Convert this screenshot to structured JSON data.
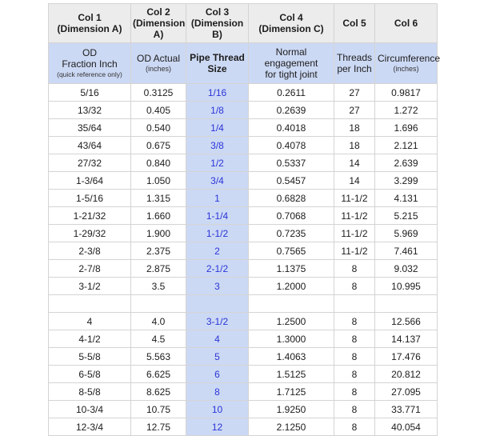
{
  "table": {
    "header_top": [
      {
        "line1": "Col 1",
        "line2": "(Dimension A)"
      },
      {
        "line1": "Col 2",
        "line2": "(Dimension A)"
      },
      {
        "line1": "Col 3",
        "line2": "(Dimension B)"
      },
      {
        "line1": "Col 4",
        "line2": "(Dimension C)"
      },
      {
        "line1": "Col 5",
        "line2": ""
      },
      {
        "line1": "Col 6",
        "line2": ""
      }
    ],
    "header_sub": [
      {
        "line1": "OD",
        "line2": "Fraction Inch",
        "note": "(quick reference only)",
        "bold": false
      },
      {
        "line1": "OD Actual",
        "line2": "",
        "note": "(inches)",
        "bold": false
      },
      {
        "line1": "Pipe Thread",
        "line2": "Size",
        "note": "",
        "bold": true
      },
      {
        "line1": "Normal engagement",
        "line2": "for tight joint",
        "note": "",
        "bold": false
      },
      {
        "line1": "Threads",
        "line2": "per Inch",
        "note": "",
        "bold": false
      },
      {
        "line1": "Circumference",
        "line2": "",
        "note": "(inches)",
        "bold": false
      }
    ],
    "rows": [
      {
        "od_fraction": "5/16",
        "od_actual": "0.3125",
        "pipe_thread_size": "1/16",
        "normal_engagement": "0.2611",
        "threads_per_inch": "27",
        "circumference": "0.9817"
      },
      {
        "od_fraction": "13/32",
        "od_actual": "0.405",
        "pipe_thread_size": "1/8",
        "normal_engagement": "0.2639",
        "threads_per_inch": "27",
        "circumference": "1.272"
      },
      {
        "od_fraction": "35/64",
        "od_actual": "0.540",
        "pipe_thread_size": "1/4",
        "normal_engagement": "0.4018",
        "threads_per_inch": "18",
        "circumference": "1.696"
      },
      {
        "od_fraction": "43/64",
        "od_actual": "0.675",
        "pipe_thread_size": "3/8",
        "normal_engagement": "0.4078",
        "threads_per_inch": "18",
        "circumference": "2.121"
      },
      {
        "od_fraction": "27/32",
        "od_actual": "0.840",
        "pipe_thread_size": "1/2",
        "normal_engagement": "0.5337",
        "threads_per_inch": "14",
        "circumference": "2.639"
      },
      {
        "od_fraction": "1-3/64",
        "od_actual": "1.050",
        "pipe_thread_size": "3/4",
        "normal_engagement": "0.5457",
        "threads_per_inch": "14",
        "circumference": "3.299"
      },
      {
        "od_fraction": "1-5/16",
        "od_actual": "1.315",
        "pipe_thread_size": "1",
        "normal_engagement": "0.6828",
        "threads_per_inch": "11-1/2",
        "circumference": "4.131"
      },
      {
        "od_fraction": "1-21/32",
        "od_actual": "1.660",
        "pipe_thread_size": "1-1/4",
        "normal_engagement": "0.7068",
        "threads_per_inch": "11-1/2",
        "circumference": "5.215"
      },
      {
        "od_fraction": "1-29/32",
        "od_actual": "1.900",
        "pipe_thread_size": "1-1/2",
        "normal_engagement": "0.7235",
        "threads_per_inch": "11-1/2",
        "circumference": "5.969"
      },
      {
        "od_fraction": "2-3/8",
        "od_actual": "2.375",
        "pipe_thread_size": "2",
        "normal_engagement": "0.7565",
        "threads_per_inch": "11-1/2",
        "circumference": "7.461"
      },
      {
        "od_fraction": "2-7/8",
        "od_actual": "2.875",
        "pipe_thread_size": "2-1/2",
        "normal_engagement": "1.1375",
        "threads_per_inch": "8",
        "circumference": "9.032"
      },
      {
        "od_fraction": "3-1/2",
        "od_actual": "3.5",
        "pipe_thread_size": "3",
        "normal_engagement": "1.2000",
        "threads_per_inch": "8",
        "circumference": "10.995"
      },
      {
        "od_fraction": "4",
        "od_actual": "4.0",
        "pipe_thread_size": "3-1/2",
        "normal_engagement": "1.2500",
        "threads_per_inch": "8",
        "circumference": "12.566"
      },
      {
        "od_fraction": "4-1/2",
        "od_actual": "4.5",
        "pipe_thread_size": "4",
        "normal_engagement": "1.3000",
        "threads_per_inch": "8",
        "circumference": "14.137"
      },
      {
        "od_fraction": "5-5/8",
        "od_actual": "5.563",
        "pipe_thread_size": "5",
        "normal_engagement": "1.4063",
        "threads_per_inch": "8",
        "circumference": "17.476"
      },
      {
        "od_fraction": "6-5/8",
        "od_actual": "6.625",
        "pipe_thread_size": "6",
        "normal_engagement": "1.5125",
        "threads_per_inch": "8",
        "circumference": "20.812"
      },
      {
        "od_fraction": "8-5/8",
        "od_actual": "8.625",
        "pipe_thread_size": "8",
        "normal_engagement": "1.7125",
        "threads_per_inch": "8",
        "circumference": "27.095"
      },
      {
        "od_fraction": "10-3/4",
        "od_actual": "10.75",
        "pipe_thread_size": "10",
        "normal_engagement": "1.9250",
        "threads_per_inch": "8",
        "circumference": "33.771"
      },
      {
        "od_fraction": "12-3/4",
        "od_actual": "12.75",
        "pipe_thread_size": "12",
        "normal_engagement": "2.1250",
        "threads_per_inch": "8",
        "circumference": "40.054"
      }
    ]
  },
  "colors": {
    "header_gray": "#ececec",
    "header_blue": "#ccd9f4",
    "thread_text_blue": "#2b35d8",
    "grid_line": "#d4d4d4",
    "page_background": "#ffffff"
  }
}
